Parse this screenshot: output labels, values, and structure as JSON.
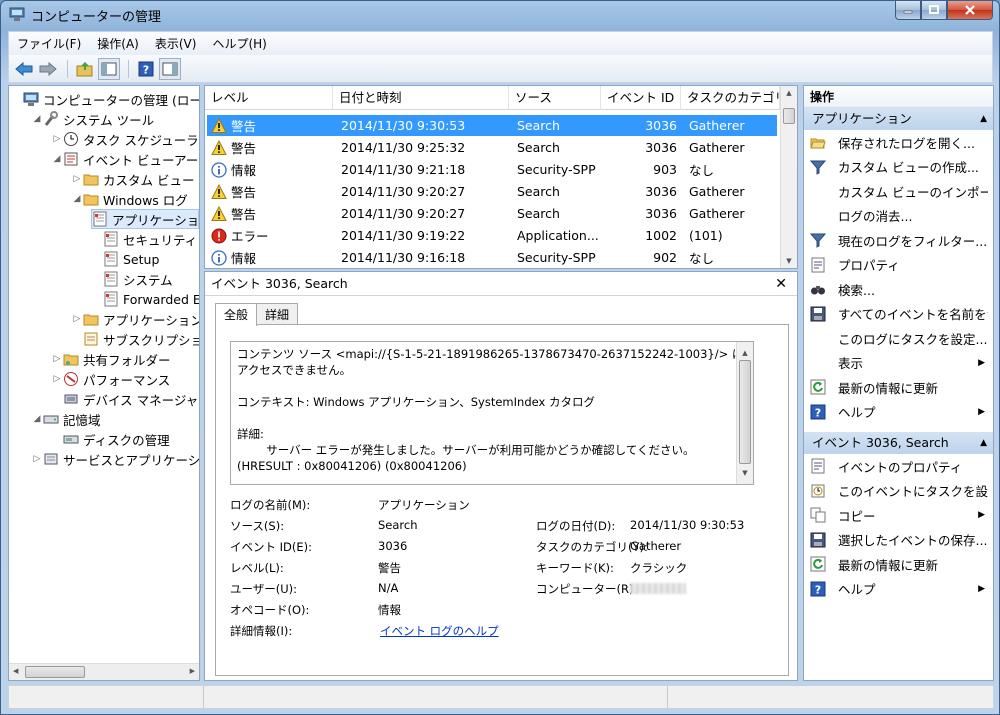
{
  "window": {
    "title": "コンピューターの管理"
  },
  "menu": [
    "ファイル(F)",
    "操作(A)",
    "表示(V)",
    "ヘルプ(H)"
  ],
  "tree": [
    {
      "label": "コンピューターの管理 (ローカル)",
      "level": 0,
      "arrow": "",
      "icon": "computer-management-icon"
    },
    {
      "label": "システム ツール",
      "level": 1,
      "arrow": "◢",
      "icon": "system-tools-icon"
    },
    {
      "label": "タスク スケジューラ",
      "level": 2,
      "arrow": "▷",
      "icon": "clock-icon"
    },
    {
      "label": "イベント ビューアー",
      "level": 2,
      "arrow": "◢",
      "icon": "event-viewer-icon"
    },
    {
      "label": "カスタム ビュー",
      "level": 3,
      "arrow": "▷",
      "icon": "folder-icon"
    },
    {
      "label": "Windows ログ",
      "level": 3,
      "arrow": "◢",
      "icon": "folder-icon"
    },
    {
      "label": "アプリケーション",
      "level": 4,
      "arrow": "",
      "icon": "log-icon",
      "selected": true
    },
    {
      "label": "セキュリティ",
      "level": 4,
      "arrow": "",
      "icon": "log-icon"
    },
    {
      "label": "Setup",
      "level": 4,
      "arrow": "",
      "icon": "log-icon"
    },
    {
      "label": "システム",
      "level": 4,
      "arrow": "",
      "icon": "log-icon"
    },
    {
      "label": "Forwarded Events",
      "level": 4,
      "arrow": "",
      "icon": "log-icon"
    },
    {
      "label": "アプリケーションとサービス",
      "level": 3,
      "arrow": "▷",
      "icon": "folder-icon"
    },
    {
      "label": "サブスクリプション",
      "level": 3,
      "arrow": "",
      "icon": "subscription-icon"
    },
    {
      "label": "共有フォルダー",
      "level": 2,
      "arrow": "▷",
      "icon": "shared-folder-icon"
    },
    {
      "label": "パフォーマンス",
      "level": 2,
      "arrow": "▷",
      "icon": "performance-icon"
    },
    {
      "label": "デバイス マネージャー",
      "level": 2,
      "arrow": "",
      "icon": "device-manager-icon"
    },
    {
      "label": "記憶域",
      "level": 1,
      "arrow": "◢",
      "icon": "storage-icon"
    },
    {
      "label": "ディスクの管理",
      "level": 2,
      "arrow": "",
      "icon": "disk-icon"
    },
    {
      "label": "サービスとアプリケーション",
      "level": 1,
      "arrow": "▷",
      "icon": "services-icon"
    }
  ],
  "events": {
    "columns": [
      "レベル",
      "日付と時刻",
      "ソース",
      "イベント ID",
      "タスクのカテゴリ"
    ],
    "rows": [
      {
        "level": "警告",
        "type": "warning",
        "datetime": "2014/11/30 9:30:53",
        "source": "Search",
        "id": "3036",
        "category": "Gatherer",
        "selected": true
      },
      {
        "level": "警告",
        "type": "warning",
        "datetime": "2014/11/30 9:25:32",
        "source": "Search",
        "id": "3036",
        "category": "Gatherer"
      },
      {
        "level": "情報",
        "type": "info",
        "datetime": "2014/11/30 9:21:18",
        "source": "Security-SPP",
        "id": "903",
        "category": "なし"
      },
      {
        "level": "警告",
        "type": "warning",
        "datetime": "2014/11/30 9:20:27",
        "source": "Search",
        "id": "3036",
        "category": "Gatherer"
      },
      {
        "level": "警告",
        "type": "warning",
        "datetime": "2014/11/30 9:20:27",
        "source": "Search",
        "id": "3036",
        "category": "Gatherer"
      },
      {
        "level": "エラー",
        "type": "error",
        "datetime": "2014/11/30 9:19:22",
        "source": "Application...",
        "id": "1002",
        "category": "(101)"
      },
      {
        "level": "情報",
        "type": "info",
        "datetime": "2014/11/30 9:16:18",
        "source": "Security-SPP",
        "id": "902",
        "category": "なし"
      }
    ]
  },
  "detail": {
    "header": "イベント 3036, Search",
    "tabs": [
      "全般",
      "詳細"
    ],
    "message": [
      "コンテンツ ソース <mapi://{S-1-5-21-1891986265-1378673470-2637152242-1003}/> にアクセスできません。",
      "コンテキスト: Windows アプリケーション、SystemIndex カタログ",
      "詳細:\n\tサーバー エラーが発生しました。サーバーが利用可能かどうか確認してください。 (HRESULT : 0x80041206) (0x80041206)"
    ],
    "fields": {
      "logname_label": "ログの名前(M):",
      "logname": "アプリケーション",
      "source_label": "ソース(S):",
      "source": "Search",
      "logdate_label": "ログの日付(D):",
      "logdate": "2014/11/30 9:30:53",
      "eventid_label": "イベント ID(E):",
      "eventid": "3036",
      "taskcat_label": "タスクのカテゴリ(Y):",
      "taskcat": "Gatherer",
      "level_label": "レベル(L):",
      "level": "警告",
      "keyword_label": "キーワード(K):",
      "keyword": "クラシック",
      "user_label": "ユーザー(U):",
      "user": "N/A",
      "computer_label": "コンピューター(R):",
      "opcode_label": "オペコード(O):",
      "opcode": "情報",
      "moreinfo_label": "詳細情報(I):",
      "moreinfo": "イベント ログのヘルプ"
    }
  },
  "actions": {
    "header": "操作",
    "section1": "アプリケーション",
    "items1": [
      {
        "label": "保存されたログを開く...",
        "icon": "open-folder-icon"
      },
      {
        "label": "カスタム ビューの作成...",
        "icon": "filter-icon"
      },
      {
        "label": "カスタム ビューのインポート...",
        "icon": ""
      },
      {
        "label": "ログの消去...",
        "icon": ""
      },
      {
        "label": "現在のログをフィルター...",
        "icon": "filter-icon"
      },
      {
        "label": "プロパティ",
        "icon": "properties-icon"
      },
      {
        "label": "検索...",
        "icon": "binoculars-icon"
      },
      {
        "label": "すべてのイベントを名前をつけて保存...",
        "icon": "save-icon"
      },
      {
        "label": "このログにタスクを設定...",
        "icon": ""
      },
      {
        "label": "表示",
        "icon": "",
        "sub": true
      },
      {
        "label": "最新の情報に更新",
        "icon": "refresh-icon"
      },
      {
        "label": "ヘルプ",
        "icon": "help-icon",
        "sub": true
      }
    ],
    "section2": "イベント 3036, Search",
    "items2": [
      {
        "label": "イベントのプロパティ",
        "icon": "properties-icon"
      },
      {
        "label": "このイベントにタスクを設定...",
        "icon": "task-icon"
      },
      {
        "label": "コピー",
        "icon": "copy-icon",
        "sub": true
      },
      {
        "label": "選択したイベントの保存...",
        "icon": "save-icon"
      },
      {
        "label": "最新の情報に更新",
        "icon": "refresh-icon"
      },
      {
        "label": "ヘルプ",
        "icon": "help-icon",
        "sub": true
      }
    ]
  }
}
